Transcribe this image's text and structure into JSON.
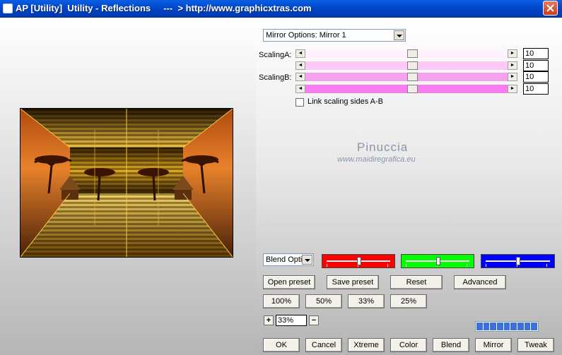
{
  "window": {
    "title": "AP [Utility]  Utility - Reflections     ---  > http://www.graphicxtras.com"
  },
  "options": {
    "mirror_select": "Mirror Options: Mirror 1",
    "blend_select": "Blend Options"
  },
  "scaling": {
    "label_a": "ScalingA:",
    "label_b": "ScalingB:",
    "sliders": [
      {
        "value": "10",
        "color": "#fdf2fd",
        "level": 0.53
      },
      {
        "value": "10",
        "color": "#fcc8f6",
        "level": 0.53
      },
      {
        "value": "10",
        "color": "#f6a1ee",
        "level": 0.53
      },
      {
        "value": "10",
        "color": "#f57ded",
        "level": 0.53
      }
    ],
    "link_label": "Link scaling sides A-B",
    "link_checked": false
  },
  "watermark": {
    "name": "Pinuccia",
    "site": "www.maidiregrafica.eu"
  },
  "color_sliders": [
    {
      "name": "red",
      "color": "#ff0000",
      "level": 0.5
    },
    {
      "name": "green",
      "color": "#00ff00",
      "level": 0.5
    },
    {
      "name": "blue",
      "color": "#0000ff",
      "level": 0.5
    }
  ],
  "buttons": {
    "open_preset": "Open preset",
    "save_preset": "Save preset",
    "reset": "Reset",
    "advanced": "Advanced",
    "zoom_100": "100%",
    "zoom_50": "50%",
    "zoom_33": "33%",
    "zoom_25": "25%",
    "plus": "+",
    "minus": "−",
    "ok": "OK",
    "cancel": "Cancel",
    "xtreme": "Xtreme",
    "color": "Color",
    "blend": "Blend",
    "mirror": "Mirror",
    "tweak": "Tweak"
  },
  "zoom_value": "33%",
  "progress_blocks": 9,
  "icons": {
    "close": "close-icon",
    "system": "app-icon",
    "checkbox": "checkbox-icon"
  }
}
